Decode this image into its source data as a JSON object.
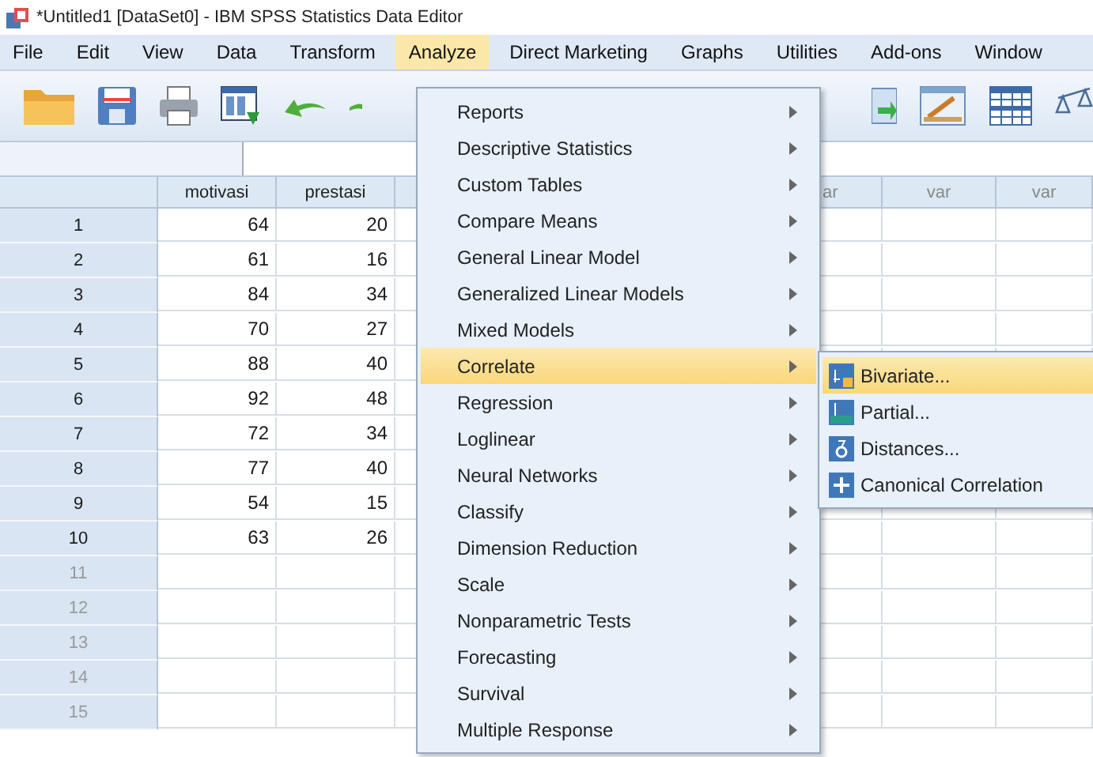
{
  "window": {
    "title": "*Untitled1 [DataSet0] - IBM SPSS Statistics Data Editor"
  },
  "menu_bar": [
    {
      "label": "File",
      "selected": false
    },
    {
      "label": "Edit",
      "selected": false
    },
    {
      "label": "View",
      "selected": false
    },
    {
      "label": "Data",
      "selected": false
    },
    {
      "label": "Transform",
      "selected": false
    },
    {
      "label": "Analyze",
      "selected": true
    },
    {
      "label": "Direct Marketing",
      "selected": false
    },
    {
      "label": "Graphs",
      "selected": false
    },
    {
      "label": "Utilities",
      "selected": false
    },
    {
      "label": "Add-ons",
      "selected": false
    },
    {
      "label": "Window",
      "selected": false
    }
  ],
  "grid": {
    "columns": [
      "motivasi",
      "prestasi",
      "ar",
      "var",
      "var"
    ],
    "rows": [
      {
        "label": "1",
        "values": [
          "64",
          "20"
        ]
      },
      {
        "label": "2",
        "values": [
          "61",
          "16"
        ]
      },
      {
        "label": "3",
        "values": [
          "84",
          "34"
        ]
      },
      {
        "label": "4",
        "values": [
          "70",
          "27"
        ]
      },
      {
        "label": "5",
        "values": [
          "88",
          "40"
        ]
      },
      {
        "label": "6",
        "values": [
          "92",
          "48"
        ]
      },
      {
        "label": "7",
        "values": [
          "72",
          "34"
        ]
      },
      {
        "label": "8",
        "values": [
          "77",
          "40"
        ]
      },
      {
        "label": "9",
        "values": [
          "54",
          "15"
        ]
      },
      {
        "label": "10",
        "values": [
          "63",
          "26"
        ]
      },
      {
        "label": "11"
      },
      {
        "label": "12"
      },
      {
        "label": "13"
      },
      {
        "label": "14"
      },
      {
        "label": "15"
      }
    ]
  },
  "analyze_menu": [
    {
      "label": "Reports",
      "selected": false,
      "submenu": true
    },
    {
      "label": "Descriptive Statistics",
      "selected": false,
      "submenu": true
    },
    {
      "label": "Custom Tables",
      "selected": false,
      "submenu": true
    },
    {
      "label": "Compare Means",
      "selected": false,
      "submenu": true
    },
    {
      "label": "General Linear Model",
      "selected": false,
      "submenu": true
    },
    {
      "label": "Generalized Linear Models",
      "selected": false,
      "submenu": true
    },
    {
      "label": "Mixed Models",
      "selected": false,
      "submenu": true
    },
    {
      "label": "Correlate",
      "selected": true,
      "submenu": true
    },
    {
      "label": "Regression",
      "selected": false,
      "submenu": true
    },
    {
      "label": "Loglinear",
      "selected": false,
      "submenu": true
    },
    {
      "label": "Neural Networks",
      "selected": false,
      "submenu": true
    },
    {
      "label": "Classify",
      "selected": false,
      "submenu": true
    },
    {
      "label": "Dimension Reduction",
      "selected": false,
      "submenu": true
    },
    {
      "label": "Scale",
      "selected": false,
      "submenu": true
    },
    {
      "label": "Nonparametric Tests",
      "selected": false,
      "submenu": true
    },
    {
      "label": "Forecasting",
      "selected": false,
      "submenu": true
    },
    {
      "label": "Survival",
      "selected": false,
      "submenu": true
    },
    {
      "label": "Multiple Response",
      "selected": false,
      "submenu": true
    }
  ],
  "correlate_submenu": [
    {
      "label": "Bivariate...",
      "selected": true,
      "kind": "bivariate"
    },
    {
      "label": "Partial...",
      "selected": false,
      "kind": "partial"
    },
    {
      "label": "Distances...",
      "selected": false,
      "kind": "distances"
    },
    {
      "label": "Canonical Correlation",
      "selected": false,
      "kind": "canonical"
    }
  ]
}
